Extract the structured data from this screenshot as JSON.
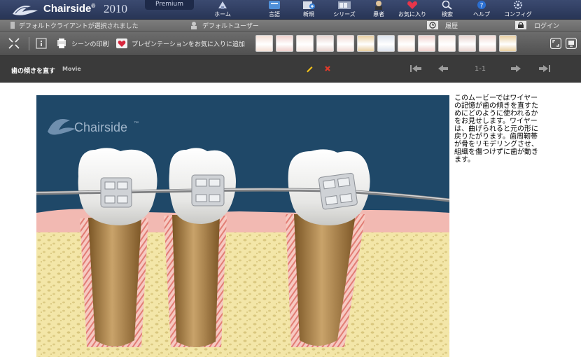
{
  "app": {
    "brand": "Chairside",
    "trademark": "®",
    "year": "2010",
    "edition": "Premium"
  },
  "nav": [
    {
      "id": "home",
      "label": "ホーム",
      "icon": "home-icon"
    },
    {
      "id": "language",
      "label": "言語",
      "icon": "language-icon"
    },
    {
      "id": "new",
      "label": "新規",
      "icon": "new-icon"
    },
    {
      "id": "series",
      "label": "シリーズ",
      "icon": "series-icon"
    },
    {
      "id": "patient",
      "label": "患者",
      "icon": "patient-icon"
    },
    {
      "id": "favorites",
      "label": "お気に入り",
      "icon": "favorites-icon"
    },
    {
      "id": "search",
      "label": "検索",
      "icon": "search-icon"
    },
    {
      "id": "help",
      "label": "ヘルプ",
      "icon": "help-icon"
    },
    {
      "id": "config",
      "label": "コンフィグ",
      "icon": "config-icon"
    }
  ],
  "status": {
    "client": "デフォルトクライアントが選択されました",
    "user": "デフォルトユーザー",
    "history": "履歴",
    "login": "ログイン"
  },
  "scene_toolbar": {
    "print_label": "シーンの印刷",
    "favorite_label": "プレゼンテーションをお気に入りに追加",
    "thumbnail_count": 13
  },
  "movie": {
    "title": "歯の傾きを直す",
    "type": "Movie",
    "pagination": "1-1"
  },
  "scene": {
    "watermark": "Chairside",
    "watermark_tm": "™"
  },
  "description": "このムービーではワイヤーの記憶が歯の傾きを直すためにどのように使われるかをお見せします。ワイヤーは、曲げられると元の形に戻りたがります。歯周靭帯が骨をリモデリングさせ、組織を傷つけずに歯が動きます。",
  "colors": {
    "topbar": "#2f3d62",
    "scene_bg": "#1f4868",
    "bone": "#f3e6a8",
    "gum": "#f2b9b2",
    "root": "#a8824a"
  }
}
